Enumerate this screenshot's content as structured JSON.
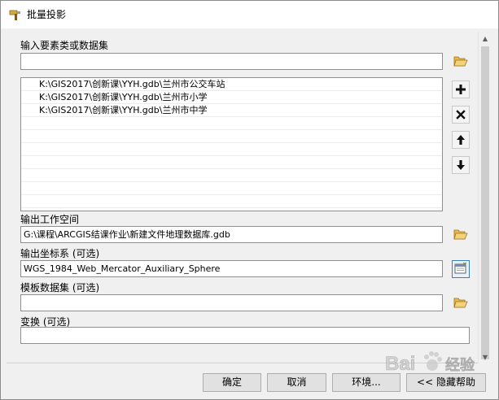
{
  "window": {
    "title": "批量投影"
  },
  "input": {
    "label": "输入要素类或数据集",
    "value": "",
    "items": [
      "K:\\GIS2017\\创新课\\YYH.gdb\\兰州市公交车站",
      "K:\\GIS2017\\创新课\\YYH.gdb\\兰州市小学",
      "K:\\GIS2017\\创新课\\YYH.gdb\\兰州市中学"
    ]
  },
  "output_workspace": {
    "label": "输出工作空间",
    "value": "G:\\课程\\ARCGIS结课作业\\新建文件地理数据库.gdb"
  },
  "output_crs": {
    "label": "输出坐标系 (可选)",
    "value": "WGS_1984_Web_Mercator_Auxiliary_Sphere"
  },
  "template_dataset": {
    "label": "模板数据集 (可选)",
    "value": ""
  },
  "transformation": {
    "label": "变换 (可选)",
    "value": ""
  },
  "buttons": {
    "ok": "确定",
    "cancel": "取消",
    "environments": "环境...",
    "hide_help": "<< 隐藏帮助"
  },
  "watermark": {
    "text": "Bai经验"
  },
  "icons": {
    "title": "hammer-icon",
    "browse": "open-folder-icon",
    "crs": "spatial-reference-icon",
    "add": "plus-icon",
    "remove": "x-icon",
    "up": "arrow-up-icon",
    "down": "arrow-down-icon"
  }
}
